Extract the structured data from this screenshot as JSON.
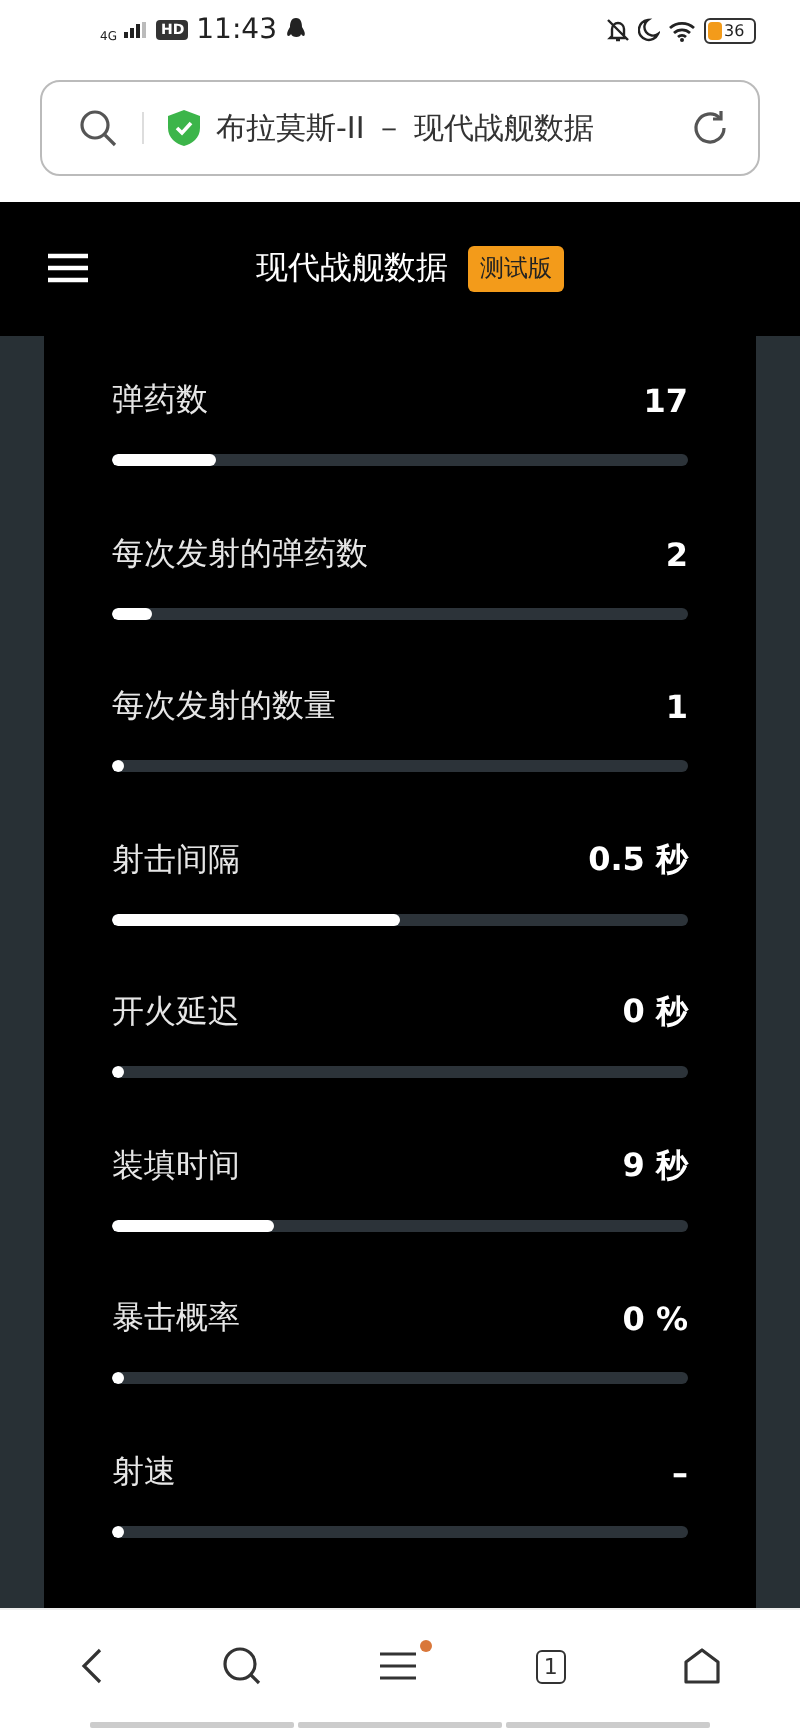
{
  "status_bar": {
    "network": "4G",
    "hd": "HD",
    "time": "11:43",
    "battery": "36"
  },
  "address_bar": {
    "title": "布拉莫斯-II － 现代战舰数据"
  },
  "header": {
    "title": "现代战舰数据",
    "badge": "测试版"
  },
  "stats": [
    {
      "label": "弹药数",
      "value": "17",
      "level": 0.18
    },
    {
      "label": "每次发射的弹药数",
      "value": "2",
      "level": 0.07
    },
    {
      "label": "每次发射的数量",
      "value": "1",
      "level": 0.02
    },
    {
      "label": "射击间隔",
      "value": "0.5 秒",
      "level": 0.5
    },
    {
      "label": "开火延迟",
      "value": "0 秒",
      "level": 0.02
    },
    {
      "label": "装填时间",
      "value": "9 秒",
      "level": 0.28
    },
    {
      "label": "暴击概率",
      "value": "0 %",
      "level": 0.02
    },
    {
      "label": "射速",
      "value": "–",
      "level": 0.02
    }
  ],
  "bottom_nav": {
    "tab_count": "1",
    "menu_notification": true
  }
}
